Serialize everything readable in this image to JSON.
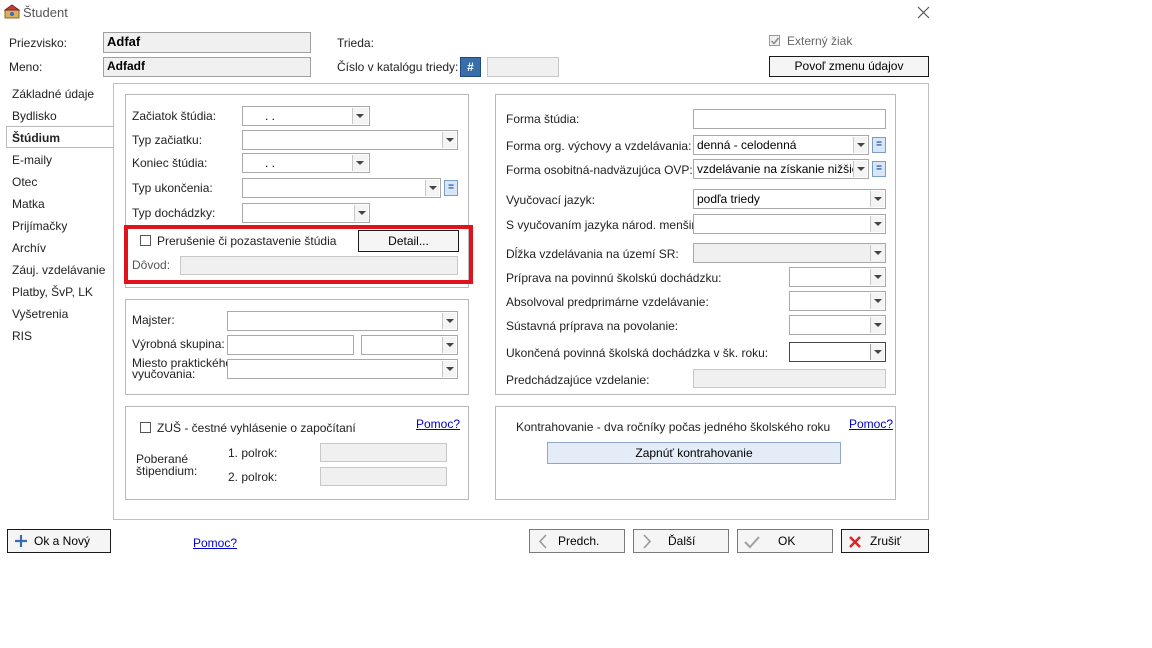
{
  "window": {
    "title": "Študent"
  },
  "header": {
    "priezvisko_label": "Priezvisko:",
    "priezvisko_value": "Adfaf",
    "meno_label": "Meno:",
    "meno_value": "Adfadf",
    "trieda_label": "Trieda:",
    "katalog_label": "Číslo v katalógu triedy:",
    "katalog_btn": "#",
    "externy_label": "Externý žiak",
    "povol_btn": "Povoľ zmenu údajov"
  },
  "sidebar": {
    "items": [
      {
        "label": "Základné údaje"
      },
      {
        "label": "Bydlisko"
      },
      {
        "label": "Štúdium"
      },
      {
        "label": "E-maily"
      },
      {
        "label": "Otec"
      },
      {
        "label": "Matka"
      },
      {
        "label": "Prijímačky"
      },
      {
        "label": "Archív"
      },
      {
        "label": "Záuj. vzdelávanie"
      },
      {
        "label": "Platby, ŠvP, LK"
      },
      {
        "label": "Vyšetrenia"
      },
      {
        "label": "RIS"
      }
    ],
    "selected": "Štúdium"
  },
  "studium": {
    "zaciatok_label": "Začiatok štúdia:",
    "zaciatok_value": ".    .",
    "typ_zaciatku_label": "Typ začiatku:",
    "koniec_label": "Koniec štúdia:",
    "koniec_value": ".    .",
    "typ_ukoncenia_label": "Typ ukončenia:",
    "typ_dochadzky_label": "Typ dochádzky:",
    "prerusenie_label": "Prerušenie či pozastavenie štúdia",
    "detail_btn": "Detail...",
    "dovod_label": "Dôvod:"
  },
  "prax": {
    "majster_label": "Majster:",
    "vyrobna_label": "Výrobná skupina:",
    "miesto_label_1": "Miesto praktického",
    "miesto_label_2": "vyučovania:"
  },
  "zus": {
    "label": "ZUŠ - čestné vyhlásenie o započítaní",
    "pomoc": "Pomoc?",
    "poberane_1": "Poberané",
    "poberane_2": "štipendium:",
    "polrok1": "1. polrok:",
    "polrok2": "2. polrok:"
  },
  "forma": {
    "forma_studia_label": "Forma štúdia:",
    "forma_org_label": "Forma org. výchovy a vzdelávania:",
    "forma_org_value": "denná - celodenná",
    "forma_ovp_label": "Forma osobitná-nadväzujúca OVP:",
    "forma_ovp_value": "vzdelávanie na získanie nižšieh",
    "jazyk_label": "Vyučovací jazyk:",
    "jazyk_value": "podľa triedy",
    "mensiny_label": "S vyučovaním jazyka národ. menšiny:",
    "dlzka_label": "Dĺžka vzdelávania na území SR:",
    "priprava_label": "Príprava na povinnú školskú dochádzku:",
    "absolvoval_label": "Absolvoval predprimárne vzdelávanie:",
    "sustavna_label": "Sústavná príprava na povolanie:",
    "ukoncena_label": "Ukončená povinná školská dochádzka v šk. roku:",
    "predchadzajuce_label": "Predchádzajúce vzdelanie:"
  },
  "kontrahovanie": {
    "label": "Kontrahovanie - dva ročníky počas jedného školského roku",
    "pomoc": "Pomoc?",
    "btn": "Zapnúť kontrahovanie"
  },
  "footer": {
    "ok_novy": "Ok a Nový",
    "pomoc": "Pomoc?",
    "predch": "Predch.",
    "dalsi": "Ďalší",
    "ok": "OK",
    "zrusit": "Zrušiť"
  },
  "colors": {
    "highlight": "#e0131d",
    "accent": "#1a4f9c"
  }
}
